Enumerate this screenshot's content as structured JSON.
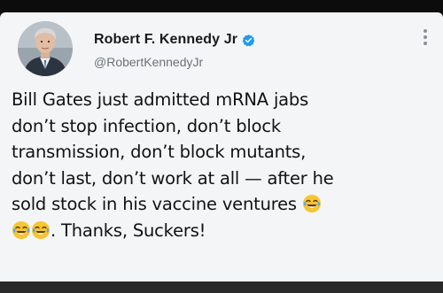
{
  "author": {
    "display_name": "Robert F. Kennedy Jr",
    "handle": "@RobertKennedyJr",
    "verified": true
  },
  "icons": {
    "verified": "verified-badge-icon",
    "more": "more-options-icon",
    "emoji": "face-with-tears-of-joy-icon"
  },
  "colors": {
    "verified_blue": "#1d9bf0",
    "text": "#121212",
    "handle": "#6b7278",
    "card_background": "#f4f5f6"
  },
  "tweet": {
    "lines": [
      "Bill Gates just admitted mRNA jabs",
      "don’t stop infection, don’t block",
      "transmission, don’t block mutants,",
      "don’t last, don’t work at all — after he",
      "sold stock in his vaccine ventures",
      ". Thanks, Suckers!"
    ]
  }
}
